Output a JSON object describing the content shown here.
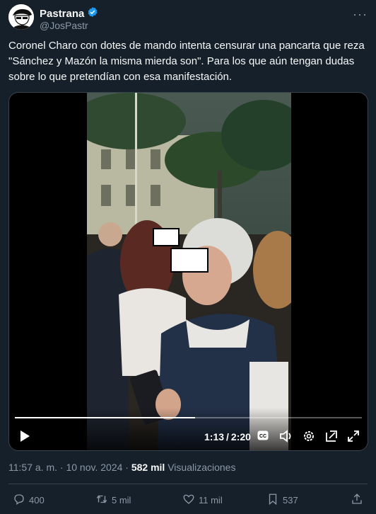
{
  "author": {
    "name": "Pastrana",
    "handle": "@JosPastr"
  },
  "tweet": {
    "text": "Coronel Charo con dotes de mando intenta censurar una pancarta que reza \"Sánchez y Mazón la misma mierda son\". Para los que aún tengan dudas sobre lo que pretendían con esa manifestación."
  },
  "video": {
    "current_time": "1:13",
    "duration": "2:20",
    "progress": 0.52,
    "cc_label": "CC"
  },
  "meta": {
    "time": "11:57 a. m.",
    "separator": "·",
    "date": "10 nov. 2024",
    "views_count": "582 mil",
    "views_label": "Visualizaciones"
  },
  "actions": {
    "replies": "400",
    "reposts": "5 mil",
    "likes": "11 mil",
    "bookmarks": "537"
  },
  "colors": {
    "background": "#15202b",
    "accent": "#1d9bf0",
    "muted": "#8b98a5"
  }
}
